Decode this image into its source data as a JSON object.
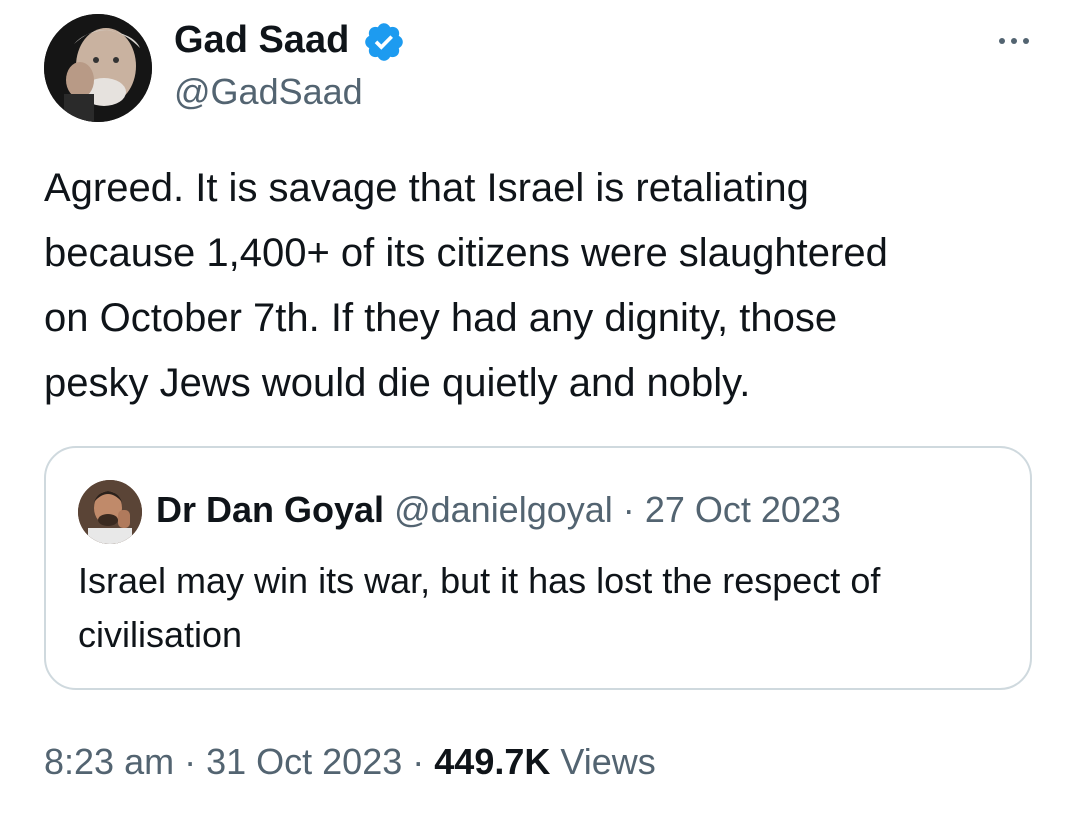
{
  "tweet": {
    "author": {
      "name": "Gad Saad",
      "handle": "@GadSaad",
      "verified": true,
      "avatar_icon": "profile-photo"
    },
    "more_icon": "more-options-icon",
    "text_lines": [
      "Agreed.  It is savage that Israel is retaliating",
      "because 1,400+ of its citizens were slaughtered",
      "on October 7th.  If they had any dignity, those",
      "pesky Jews would die quietly and nobly."
    ],
    "quote": {
      "name": "Dr Dan Goyal",
      "handle": "@danielgoyal",
      "separator": "·",
      "date": "27 Oct 2023",
      "text_lines": [
        "Israel may win its war, but it has lost the respect of",
        "civilisation"
      ]
    },
    "meta": {
      "time": "8:23 am",
      "separator": "·",
      "date": "31 Oct 2023",
      "views_count": "449.7K",
      "views_label": "Views"
    }
  },
  "colors": {
    "text_primary": "#0f1419",
    "text_secondary": "#536471",
    "verified_blue": "#1d9bf0",
    "border": "#cfd9de"
  }
}
